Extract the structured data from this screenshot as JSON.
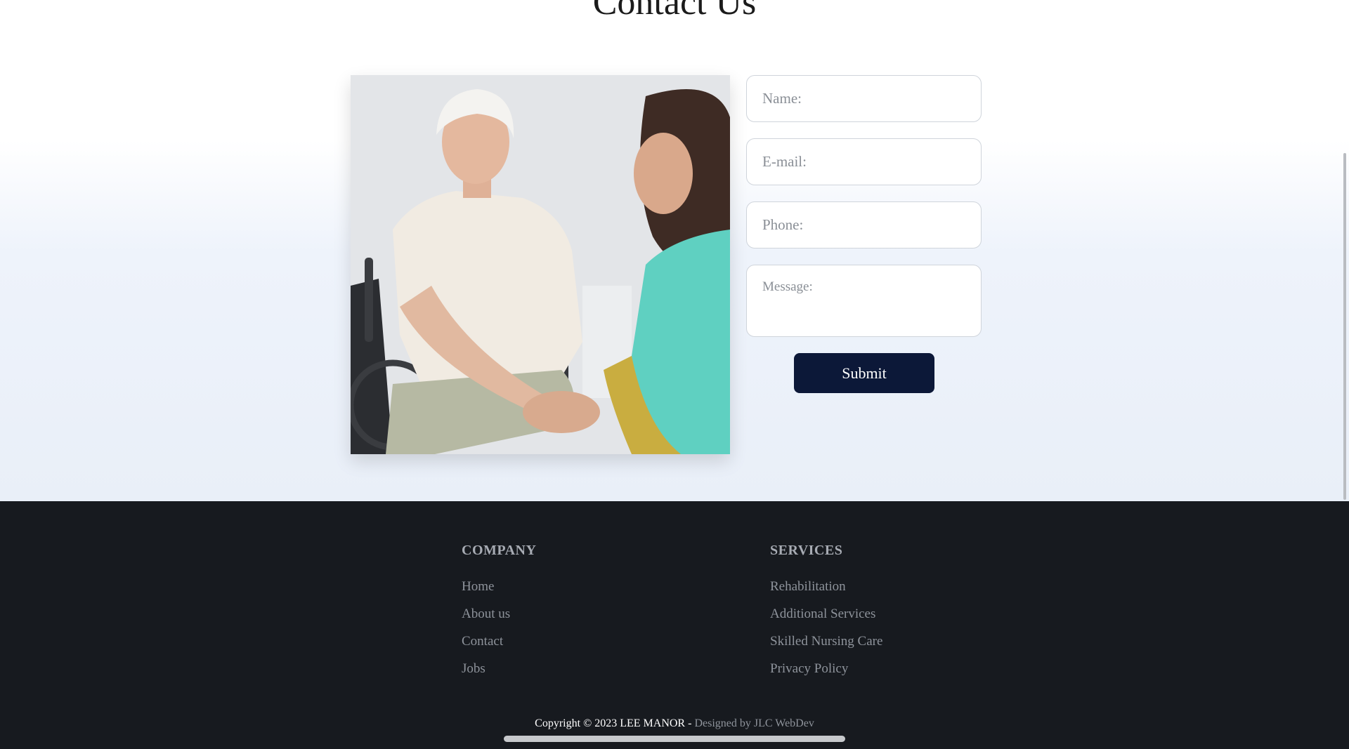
{
  "contact": {
    "title": "Contact Us",
    "form": {
      "name_placeholder": "Name:",
      "email_placeholder": "E-mail:",
      "phone_placeholder": "Phone:",
      "message_placeholder": "Message:",
      "submit_label": "Submit",
      "accent_color": "#0c1838"
    }
  },
  "footer": {
    "company": {
      "heading": "COMPANY",
      "links": [
        "Home",
        "About us",
        "Contact",
        "Jobs"
      ]
    },
    "services": {
      "heading": "SERVICES",
      "links": [
        "Rehabilitation",
        "Additional Services",
        "Skilled Nursing Care",
        "Privacy Policy"
      ]
    },
    "copyright": "Copyright © 2023 LEE MANOR - ",
    "designer": "Designed by JLC WebDev",
    "background_color": "#171a1f"
  }
}
